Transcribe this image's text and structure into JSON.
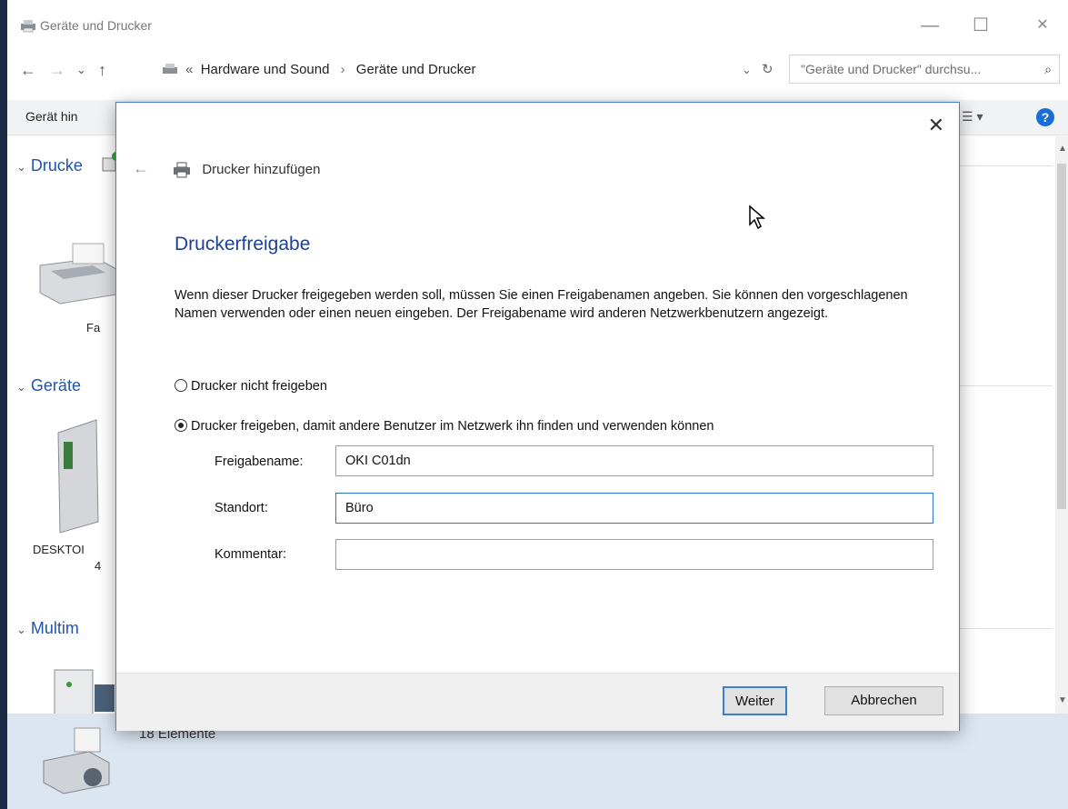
{
  "window": {
    "title": "Geräte und Drucker",
    "min_glyph": "—",
    "max_glyph": "☐",
    "close_glyph": "✕"
  },
  "nav": {
    "back_glyph": "←",
    "forward_glyph": "→",
    "recent_glyph": "⌄",
    "up_glyph": "↑",
    "breadcrumb_overflow": "«",
    "breadcrumb": [
      "Hardware und Sound",
      "Geräte und Drucker"
    ],
    "crumb_sep": "›",
    "dropdown_glyph": "⌄",
    "refresh_glyph": "↻",
    "search_placeholder": "\"Geräte und Drucker\" durchsu...",
    "search_icon": "⌕"
  },
  "toolbar": {
    "first_item": "Gerät hin",
    "view_label": "☰  ▾",
    "help_label": "?"
  },
  "groups": [
    {
      "label": "Drucke",
      "chevron": "⌄"
    },
    {
      "label": "Geräte",
      "chevron": "⌄"
    },
    {
      "label": "Multim",
      "chevron": "⌄"
    }
  ],
  "device_labels": [
    "Fa",
    "DESKTOI",
    "4"
  ],
  "status": {
    "count": "18 Elemente"
  },
  "dialog": {
    "close_glyph": "✕",
    "back_glyph": "←",
    "header_title": "Drucker hinzufügen",
    "heading": "Druckerfreigabe",
    "description": "Wenn dieser Drucker freigegeben werden soll, müssen Sie einen Freigabenamen angeben. Sie können den vorgeschlagenen Namen verwenden oder einen neuen eingeben. Der Freigabename wird anderen Netzwerkbenutzern angezeigt.",
    "radio_no_share": "Drucker nicht freigeben",
    "radio_share": "Drucker freigeben, damit andere Benutzer im Netzwerk ihn finden und verwenden können",
    "share_selected": true,
    "fields": {
      "share_name_label": "Freigabename:",
      "share_name_value": "OKI C01dn",
      "location_label": "Standort:",
      "location_value": "Büro",
      "comment_label": "Kommentar:",
      "comment_value": ""
    },
    "next_button": "Weiter",
    "cancel_button": "Abbrechen"
  }
}
